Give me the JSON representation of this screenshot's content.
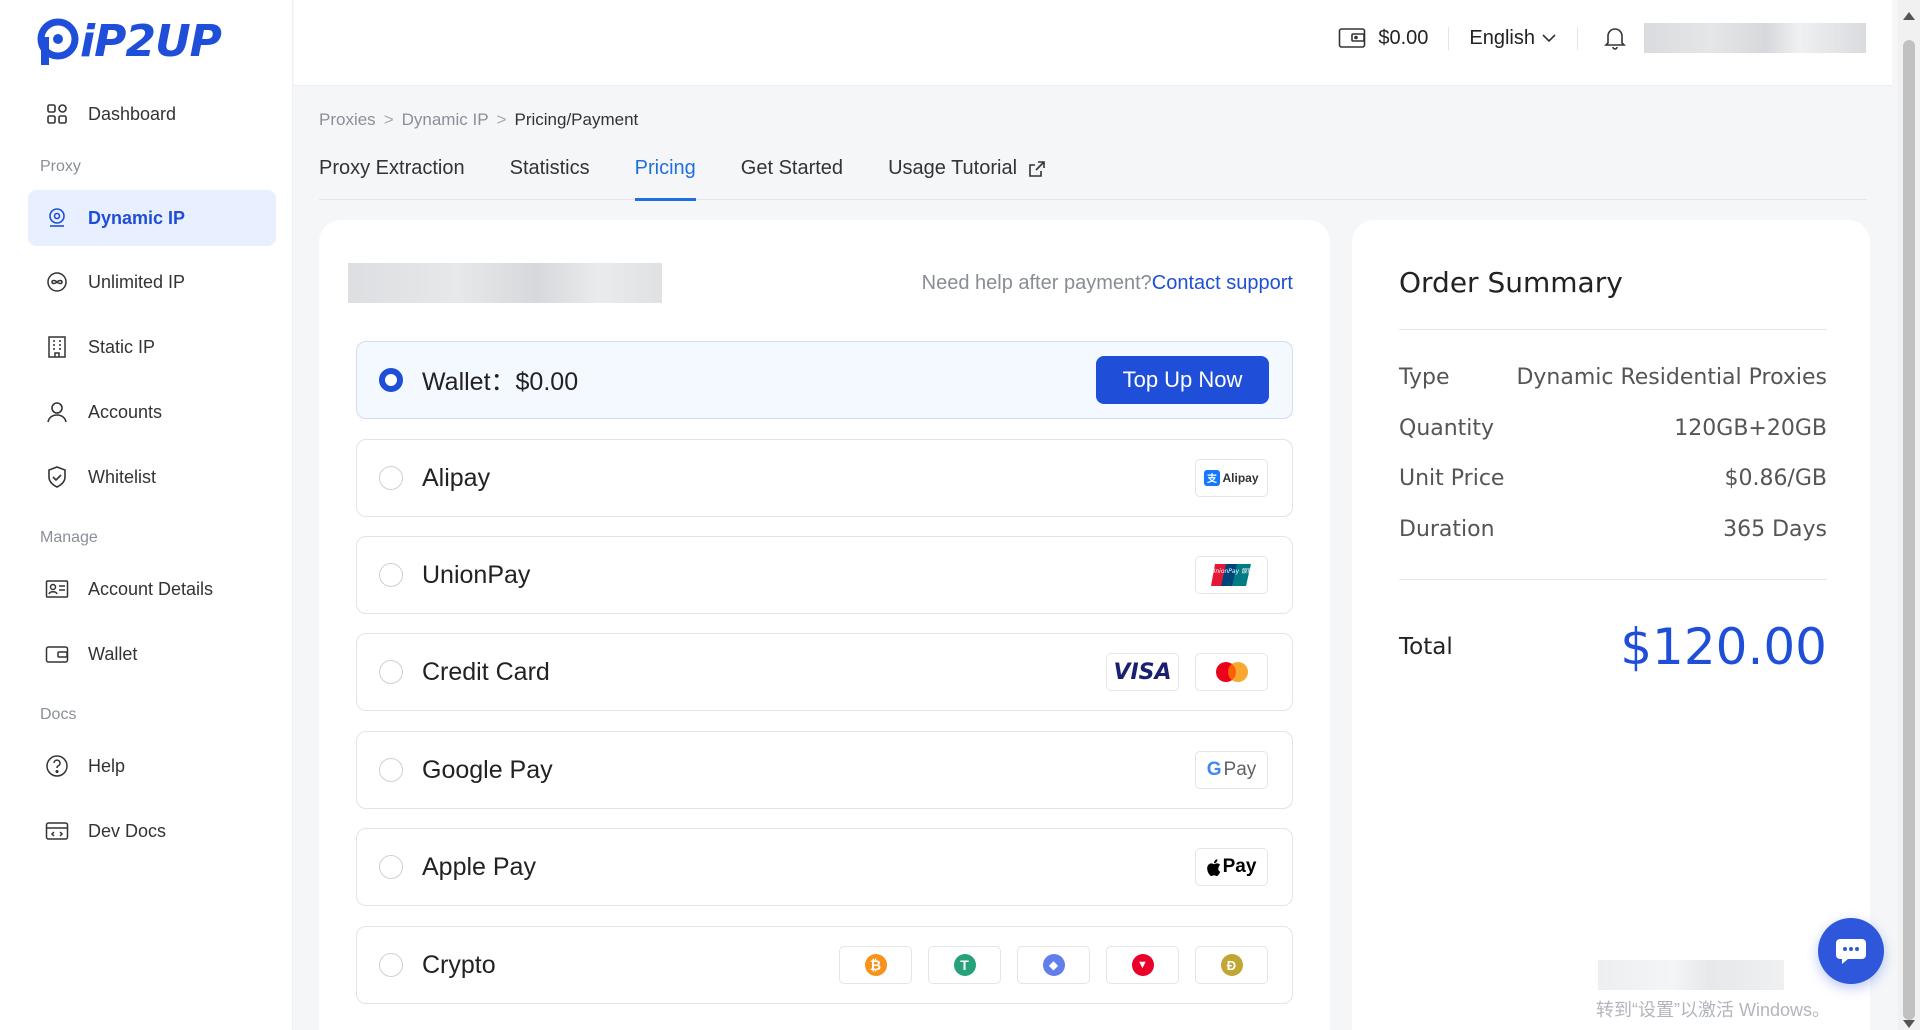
{
  "brand": {
    "name": "iP2UP",
    "color": "#1f4fd8"
  },
  "sidebar": {
    "top_item": {
      "label": "Dashboard",
      "icon": "grid-icon"
    },
    "sections": [
      {
        "title": "Proxy",
        "items": [
          {
            "label": "Dynamic IP",
            "icon": "location-pin-icon",
            "active": true
          },
          {
            "label": "Unlimited IP",
            "icon": "infinity-icon",
            "active": false
          },
          {
            "label": "Static IP",
            "icon": "building-icon",
            "active": false
          },
          {
            "label": "Accounts",
            "icon": "user-icon",
            "active": false
          },
          {
            "label": "Whitelist",
            "icon": "shield-icon",
            "active": false
          }
        ]
      },
      {
        "title": "Manage",
        "items": [
          {
            "label": "Account Details",
            "icon": "id-card-icon",
            "active": false
          },
          {
            "label": "Wallet",
            "icon": "wallet-icon",
            "active": false
          }
        ]
      },
      {
        "title": "Docs",
        "items": [
          {
            "label": "Help",
            "icon": "question-circle-icon",
            "active": false
          },
          {
            "label": "Dev Docs",
            "icon": "code-doc-icon",
            "active": false
          }
        ]
      }
    ]
  },
  "header": {
    "wallet_balance": "$0.00",
    "language": "English"
  },
  "breadcrumb": {
    "items": [
      "Proxies",
      "Dynamic IP"
    ],
    "current": "Pricing/Payment"
  },
  "tabs": [
    {
      "label": "Proxy Extraction",
      "active": false
    },
    {
      "label": "Statistics",
      "active": false
    },
    {
      "label": "Pricing",
      "active": true
    },
    {
      "label": "Get Started",
      "active": false
    },
    {
      "label": "Usage Tutorial",
      "active": false,
      "external": true
    }
  ],
  "payment": {
    "help_prefix": "Need help after payment?",
    "help_link": "Contact support",
    "wallet": {
      "label": "Wallet：",
      "balance": "$0.00",
      "button": "Top Up Now",
      "selected": true
    },
    "methods": [
      {
        "label": "Alipay",
        "badges": [
          {
            "text": "Alipay",
            "icon": "alipay-icon"
          }
        ]
      },
      {
        "label": "UnionPay",
        "badges": [
          {
            "text": "UnionPay 银联",
            "icon": "unionpay-icon"
          }
        ]
      },
      {
        "label": "Credit Card",
        "badges": [
          {
            "text": "VISA",
            "icon": "visa-icon"
          },
          {
            "text": "",
            "icon": "mastercard-icon"
          }
        ]
      },
      {
        "label": "Google Pay",
        "badges": [
          {
            "text": "Pay",
            "icon": "google-pay-icon"
          }
        ]
      },
      {
        "label": "Apple Pay",
        "badges": [
          {
            "text": "Pay",
            "icon": "apple-pay-icon"
          }
        ]
      },
      {
        "label": "Crypto",
        "badges": [
          {
            "text": "₿",
            "icon": "bitcoin-icon",
            "color": "#f7931a"
          },
          {
            "text": "T",
            "icon": "tether-icon",
            "color": "#26a17b"
          },
          {
            "text": "◆",
            "icon": "ethereum-icon",
            "color": "#627eea"
          },
          {
            "text": "▼",
            "icon": "tron-icon",
            "color": "#eb0029"
          },
          {
            "text": "Ð",
            "icon": "dogecoin-icon",
            "color": "#c2a633"
          }
        ]
      }
    ]
  },
  "order_summary": {
    "title": "Order Summary",
    "rows": [
      {
        "label": "Type",
        "value": "Dynamic Residential Proxies"
      },
      {
        "label": "Quantity",
        "value": "120GB+20GB"
      },
      {
        "label": "Unit Price",
        "value": "$0.86/GB"
      },
      {
        "label": "Duration",
        "value": "365 Days"
      }
    ],
    "total_label": "Total",
    "total_value": "$120.00"
  },
  "watermark": {
    "text": "转到“设置”以激活 Windows。"
  },
  "colors": {
    "accent": "#1f4fd8",
    "tab_active": "#1f6fe0",
    "active_bg": "#e8efff"
  }
}
